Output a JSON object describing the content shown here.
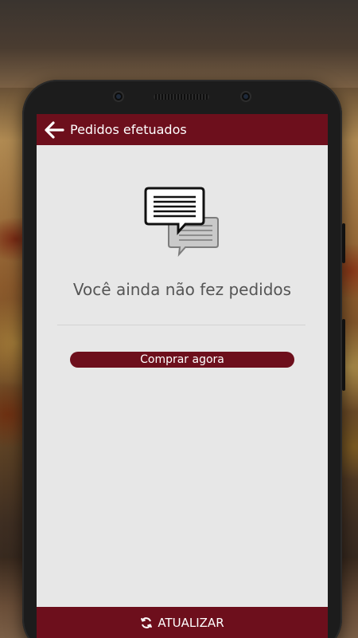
{
  "colors": {
    "brand": "#6d0f1c",
    "screen_background": "#e7e7e7",
    "message_text": "#555555"
  },
  "appbar": {
    "title": "Pedidos efetuados",
    "back_icon": "arrow-left-icon"
  },
  "empty_state": {
    "icon": "chat-bubbles-icon",
    "message": "Você ainda não fez pedidos"
  },
  "actions": {
    "buy_label": "Comprar agora"
  },
  "bottom_bar": {
    "icon": "refresh-icon",
    "label": "ATUALIZAR"
  }
}
